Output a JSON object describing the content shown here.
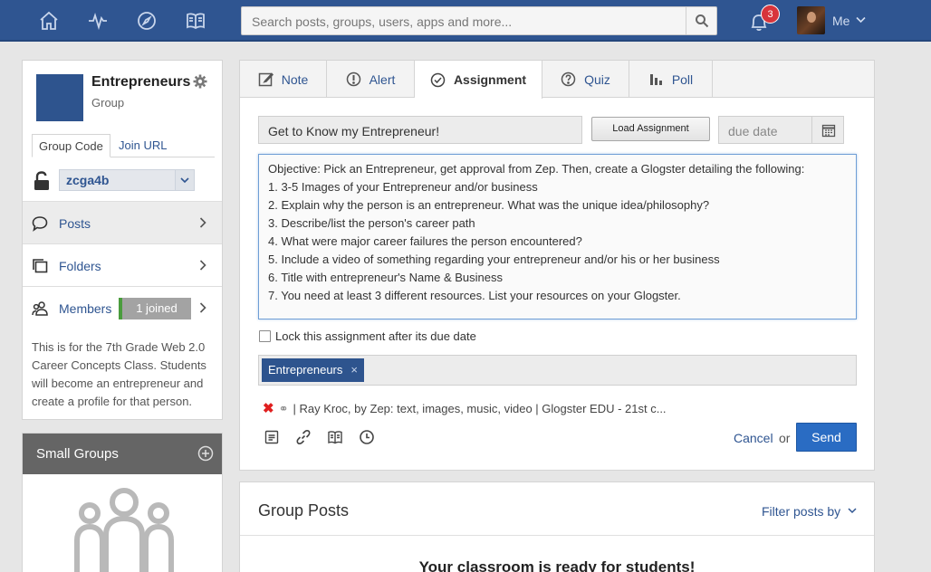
{
  "topnav": {
    "search_placeholder": "Search posts, groups, users, apps and more...",
    "notification_count": "3",
    "user_label": "Me"
  },
  "group": {
    "name": "Entrepreneurs",
    "type": "Group",
    "code_tab": "Group Code",
    "url_tab": "Join URL",
    "code": "zcga4b",
    "menu": [
      {
        "label": "Posts"
      },
      {
        "label": "Folders"
      },
      {
        "label": "Members",
        "badge": "1 joined"
      }
    ],
    "description": "This is for the 7th Grade Web 2.0 Career Concepts Class. Students will become an entrepreneur and create a profile for that person."
  },
  "small_groups": {
    "title": "Small Groups"
  },
  "composer": {
    "tabs": [
      {
        "label": "Note",
        "icon": "note-icon"
      },
      {
        "label": "Alert",
        "icon": "alert-icon"
      },
      {
        "label": "Assignment",
        "icon": "check-circle-icon",
        "active": true
      },
      {
        "label": "Quiz",
        "icon": "question-icon"
      },
      {
        "label": "Poll",
        "icon": "bar-chart-icon"
      }
    ],
    "title_value": "Get to Know my Entrepreneur!",
    "load_button": "Load Assignment",
    "due_placeholder": "due date",
    "body_lines": [
      "Objective:  Pick an Entrepreneur, get approval from Zep. Then, create a Glogster detailing the following:",
      "1.  3-5 Images of your Entrepreneur and/or business",
      "2.  Explain why the person is an entrepreneur. What was the unique idea/philosophy?",
      "3.  Describe/list the person's career path",
      "4.  What were major career failures the person encountered?",
      "5.  Include a video of something regarding your entrepreneur and/or his or her business",
      "6.  Title with entrepreneur's Name & Business",
      "7.  You need at least 3 different resources.  List your resources on your Glogster."
    ],
    "lock_label": "Lock this assignment after its due date",
    "recipient_chip": "Entrepreneurs",
    "chip_remove": "×",
    "attachment": "| Ray Kroc, by Zep: text, images, music, video | Glogster EDU - 21st c...",
    "cancel": "Cancel",
    "or": "or",
    "send": "Send"
  },
  "posts": {
    "title": "Group Posts",
    "filter": "Filter posts by",
    "ready_message": "Your classroom is ready for students!"
  },
  "colors": {
    "nav": "#2f5591",
    "accent": "#2a6cc3",
    "badge": "#d8343b"
  }
}
